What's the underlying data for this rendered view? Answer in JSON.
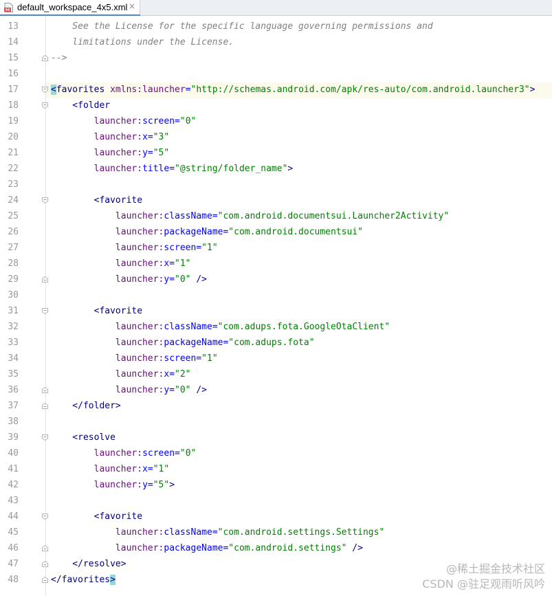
{
  "editor": {
    "tab": {
      "label": "default_workspace_4x5.xml",
      "icon": "xml-file-icon",
      "close_label": "×"
    },
    "caret_line": 17,
    "colors": {
      "comment": "#808080",
      "tag": "#000080",
      "namespace": "#660e7a",
      "attribute": "#0000ff",
      "value": "#008000",
      "brace_match": "#93d9d9",
      "caret_line_bg": "#fcfaed",
      "line_number": "#999999"
    },
    "lines": [
      {
        "n": "13",
        "tokens": [
          {
            "t": "    See the License for the specific language governing permissions and",
            "c": "comment"
          }
        ]
      },
      {
        "n": "14",
        "tokens": [
          {
            "t": "    limitations under the License.",
            "c": "comment"
          }
        ]
      },
      {
        "n": "15",
        "fold": "end",
        "tokens": [
          {
            "t": "-->",
            "c": "comment"
          }
        ]
      },
      {
        "n": "16",
        "tokens": []
      },
      {
        "n": "17",
        "fold": "start",
        "tokens": [
          {
            "t": "<",
            "c": "tag",
            "hl": true
          },
          {
            "t": "favorites ",
            "c": "tag"
          },
          {
            "t": "xmlns:",
            "c": "ns"
          },
          {
            "t": "launcher",
            "c": "ns"
          },
          {
            "t": "=",
            "c": "attr"
          },
          {
            "t": "\"http://schemas.android.com/apk/res-auto/com.android.launcher3\"",
            "c": "val"
          },
          {
            "t": ">",
            "c": "tag"
          }
        ]
      },
      {
        "n": "18",
        "fold": "start",
        "tokens": [
          {
            "t": "    <folder",
            "c": "tag"
          }
        ]
      },
      {
        "n": "19",
        "tokens": [
          {
            "t": "        ",
            "c": "tag"
          },
          {
            "t": "launcher:",
            "c": "ns"
          },
          {
            "t": "screen",
            "c": "attr"
          },
          {
            "t": "=",
            "c": "attr"
          },
          {
            "t": "\"0\"",
            "c": "val"
          }
        ]
      },
      {
        "n": "20",
        "tokens": [
          {
            "t": "        ",
            "c": "tag"
          },
          {
            "t": "launcher:",
            "c": "ns"
          },
          {
            "t": "x",
            "c": "attr"
          },
          {
            "t": "=",
            "c": "attr"
          },
          {
            "t": "\"3\"",
            "c": "val"
          }
        ]
      },
      {
        "n": "21",
        "tokens": [
          {
            "t": "        ",
            "c": "tag"
          },
          {
            "t": "launcher:",
            "c": "ns"
          },
          {
            "t": "y",
            "c": "attr"
          },
          {
            "t": "=",
            "c": "attr"
          },
          {
            "t": "\"5\"",
            "c": "val"
          }
        ]
      },
      {
        "n": "22",
        "tokens": [
          {
            "t": "        ",
            "c": "tag"
          },
          {
            "t": "launcher:",
            "c": "ns"
          },
          {
            "t": "title",
            "c": "attr"
          },
          {
            "t": "=",
            "c": "attr"
          },
          {
            "t": "\"@string/folder_name\"",
            "c": "val"
          },
          {
            "t": ">",
            "c": "tag"
          }
        ]
      },
      {
        "n": "23",
        "tokens": []
      },
      {
        "n": "24",
        "fold": "start",
        "tokens": [
          {
            "t": "        <favorite",
            "c": "tag"
          }
        ]
      },
      {
        "n": "25",
        "tokens": [
          {
            "t": "            ",
            "c": "tag"
          },
          {
            "t": "launcher:",
            "c": "ns"
          },
          {
            "t": "className",
            "c": "attr"
          },
          {
            "t": "=",
            "c": "attr"
          },
          {
            "t": "\"com.android.documentsui.Launcher2Activity\"",
            "c": "val"
          }
        ]
      },
      {
        "n": "26",
        "tokens": [
          {
            "t": "            ",
            "c": "tag"
          },
          {
            "t": "launcher:",
            "c": "ns"
          },
          {
            "t": "packageName",
            "c": "attr"
          },
          {
            "t": "=",
            "c": "attr"
          },
          {
            "t": "\"com.android.documentsui\"",
            "c": "val"
          }
        ]
      },
      {
        "n": "27",
        "tokens": [
          {
            "t": "            ",
            "c": "tag"
          },
          {
            "t": "launcher:",
            "c": "ns"
          },
          {
            "t": "screen",
            "c": "attr"
          },
          {
            "t": "=",
            "c": "attr"
          },
          {
            "t": "\"1\"",
            "c": "val"
          }
        ]
      },
      {
        "n": "28",
        "tokens": [
          {
            "t": "            ",
            "c": "tag"
          },
          {
            "t": "launcher:",
            "c": "ns"
          },
          {
            "t": "x",
            "c": "attr"
          },
          {
            "t": "=",
            "c": "attr"
          },
          {
            "t": "\"1\"",
            "c": "val"
          }
        ]
      },
      {
        "n": "29",
        "fold": "end",
        "tokens": [
          {
            "t": "            ",
            "c": "tag"
          },
          {
            "t": "launcher:",
            "c": "ns"
          },
          {
            "t": "y",
            "c": "attr"
          },
          {
            "t": "=",
            "c": "attr"
          },
          {
            "t": "\"0\"",
            "c": "val"
          },
          {
            "t": " />",
            "c": "tag"
          }
        ]
      },
      {
        "n": "30",
        "tokens": []
      },
      {
        "n": "31",
        "fold": "start",
        "tokens": [
          {
            "t": "        <favorite",
            "c": "tag"
          }
        ]
      },
      {
        "n": "32",
        "tokens": [
          {
            "t": "            ",
            "c": "tag"
          },
          {
            "t": "launcher:",
            "c": "ns"
          },
          {
            "t": "className",
            "c": "attr"
          },
          {
            "t": "=",
            "c": "attr"
          },
          {
            "t": "\"com.adups.fota.GoogleOtaClient\"",
            "c": "val"
          }
        ]
      },
      {
        "n": "33",
        "tokens": [
          {
            "t": "            ",
            "c": "tag"
          },
          {
            "t": "launcher:",
            "c": "ns"
          },
          {
            "t": "packageName",
            "c": "attr"
          },
          {
            "t": "=",
            "c": "attr"
          },
          {
            "t": "\"com.adups.fota\"",
            "c": "val"
          }
        ]
      },
      {
        "n": "34",
        "tokens": [
          {
            "t": "            ",
            "c": "tag"
          },
          {
            "t": "launcher:",
            "c": "ns"
          },
          {
            "t": "screen",
            "c": "attr"
          },
          {
            "t": "=",
            "c": "attr"
          },
          {
            "t": "\"1\"",
            "c": "val"
          }
        ]
      },
      {
        "n": "35",
        "tokens": [
          {
            "t": "            ",
            "c": "tag"
          },
          {
            "t": "launcher:",
            "c": "ns"
          },
          {
            "t": "x",
            "c": "attr"
          },
          {
            "t": "=",
            "c": "attr"
          },
          {
            "t": "\"2\"",
            "c": "val"
          }
        ]
      },
      {
        "n": "36",
        "fold": "end",
        "tokens": [
          {
            "t": "            ",
            "c": "tag"
          },
          {
            "t": "launcher:",
            "c": "ns"
          },
          {
            "t": "y",
            "c": "attr"
          },
          {
            "t": "=",
            "c": "attr"
          },
          {
            "t": "\"0\"",
            "c": "val"
          },
          {
            "t": " />",
            "c": "tag"
          }
        ]
      },
      {
        "n": "37",
        "fold": "end",
        "tokens": [
          {
            "t": "    </folder>",
            "c": "tag"
          }
        ]
      },
      {
        "n": "38",
        "tokens": []
      },
      {
        "n": "39",
        "fold": "start",
        "tokens": [
          {
            "t": "    <resolve",
            "c": "tag"
          }
        ]
      },
      {
        "n": "40",
        "tokens": [
          {
            "t": "        ",
            "c": "tag"
          },
          {
            "t": "launcher:",
            "c": "ns"
          },
          {
            "t": "screen",
            "c": "attr"
          },
          {
            "t": "=",
            "c": "attr"
          },
          {
            "t": "\"0\"",
            "c": "val"
          }
        ]
      },
      {
        "n": "41",
        "tokens": [
          {
            "t": "        ",
            "c": "tag"
          },
          {
            "t": "launcher:",
            "c": "ns"
          },
          {
            "t": "x",
            "c": "attr"
          },
          {
            "t": "=",
            "c": "attr"
          },
          {
            "t": "\"1\"",
            "c": "val"
          }
        ]
      },
      {
        "n": "42",
        "tokens": [
          {
            "t": "        ",
            "c": "tag"
          },
          {
            "t": "launcher:",
            "c": "ns"
          },
          {
            "t": "y",
            "c": "attr"
          },
          {
            "t": "=",
            "c": "attr"
          },
          {
            "t": "\"5\"",
            "c": "val"
          },
          {
            "t": ">",
            "c": "tag"
          }
        ]
      },
      {
        "n": "43",
        "tokens": []
      },
      {
        "n": "44",
        "fold": "start",
        "tokens": [
          {
            "t": "        <favorite",
            "c": "tag"
          }
        ]
      },
      {
        "n": "45",
        "tokens": [
          {
            "t": "            ",
            "c": "tag"
          },
          {
            "t": "launcher:",
            "c": "ns"
          },
          {
            "t": "className",
            "c": "attr"
          },
          {
            "t": "=",
            "c": "attr"
          },
          {
            "t": "\"com.android.settings.Settings\"",
            "c": "val"
          }
        ]
      },
      {
        "n": "46",
        "fold": "end",
        "tokens": [
          {
            "t": "            ",
            "c": "tag"
          },
          {
            "t": "launcher:",
            "c": "ns"
          },
          {
            "t": "packageName",
            "c": "attr"
          },
          {
            "t": "=",
            "c": "attr"
          },
          {
            "t": "\"com.android.settings\"",
            "c": "val"
          },
          {
            "t": " />",
            "c": "tag"
          }
        ]
      },
      {
        "n": "47",
        "fold": "end",
        "tokens": [
          {
            "t": "    </resolve>",
            "c": "tag"
          }
        ]
      },
      {
        "n": "48",
        "fold": "end",
        "tokens": [
          {
            "t": "</favorites",
            "c": "tag"
          },
          {
            "t": ">",
            "c": "tag",
            "hl": true
          }
        ]
      }
    ]
  },
  "watermark": {
    "line1": "@稀土掘金技术社区",
    "line2": "CSDN @驻足观雨听风吟"
  }
}
